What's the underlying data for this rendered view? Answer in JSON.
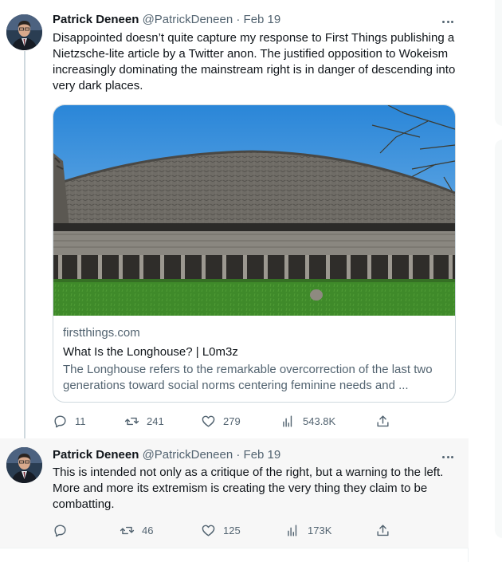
{
  "tweets": [
    {
      "author": {
        "name": "Patrick Deneen",
        "handle": "@PatrickDeneen"
      },
      "separator": "·",
      "date": "Feb 19",
      "text": "Disappointed doesn’t quite capture my response to First Things publishing a Nietzsche-lite article by a Twitter anon.  The justified opposition to Wokeism increasingly dominating the mainstream right is in danger of descending  into very dark places.",
      "card": {
        "domain": "firstthings.com",
        "title": "What Is the Longhouse? | L0m3z",
        "description": "The Longhouse refers to the remarkable overcorrection of the last two generations toward social norms centering feminine needs and ..."
      },
      "stats": {
        "replies": "11",
        "retweets": "241",
        "likes": "279",
        "views": "543.8K"
      }
    },
    {
      "author": {
        "name": "Patrick Deneen",
        "handle": "@PatrickDeneen"
      },
      "separator": "·",
      "date": "Feb 19",
      "text": "This is intended not only as a critique of the right, but a warning to the left.  More and more its extremism is creating the very thing they claim to be combatting.",
      "stats": {
        "replies": "",
        "retweets": "46",
        "likes": "125",
        "views": "173K"
      }
    }
  ],
  "icons": [
    "reply-icon",
    "retweet-icon",
    "like-icon",
    "views-icon",
    "share-icon",
    "more-icon"
  ],
  "colors": {
    "text": "#0f1419",
    "secondary": "#536471",
    "border": "#cfd9de"
  }
}
